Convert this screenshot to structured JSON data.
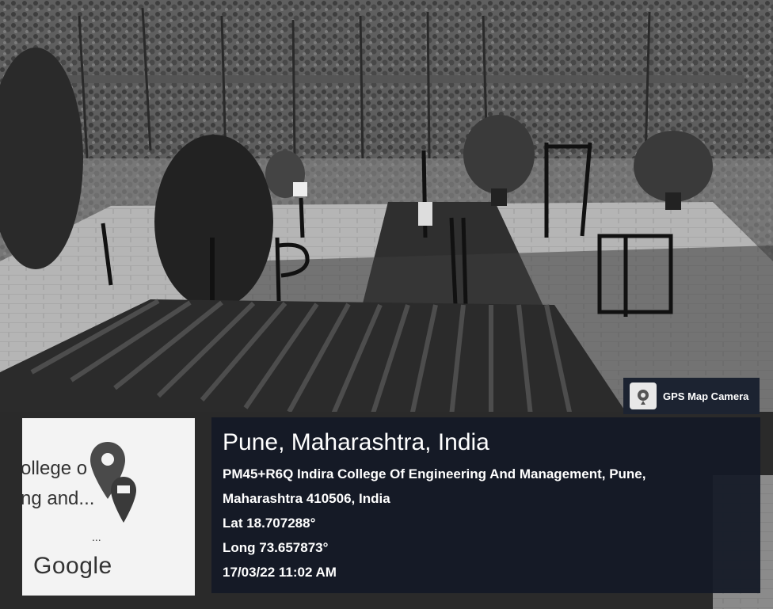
{
  "watermark": {
    "app_name": "GPS Map Camera",
    "icon": "camera-pin-icon"
  },
  "map_thumbnail": {
    "label_line1": "ollege o",
    "label_line2": "ng and...",
    "ellipsis": "...",
    "provider": "Google",
    "icon": "map-pin-icon"
  },
  "location": {
    "title": "Pune, Maharashtra, India",
    "address_line1": "PM45+R6Q Indira College Of Engineering And Management, Pune,",
    "address_line2": "Maharashtra 410506, India",
    "latitude": "Lat 18.707288°",
    "longitude": "Long 73.657873°",
    "timestamp": "17/03/22 11:02 AM"
  }
}
